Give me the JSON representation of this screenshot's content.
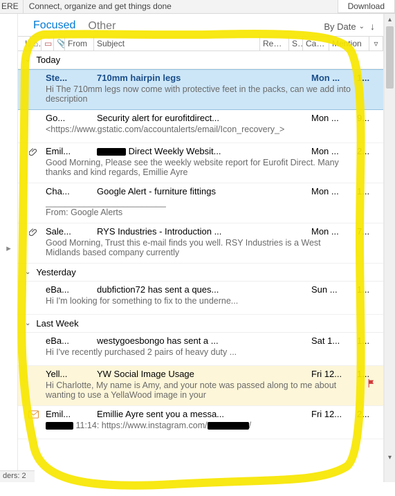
{
  "ribbon": {
    "truncated_tab": "ERE",
    "tagline": "Connect, organize and get things done",
    "download": "Download"
  },
  "tabs": {
    "focused": "Focused",
    "other": "Other",
    "sort_label": "By Date",
    "sort_chev": "⌄",
    "sort_dir": "↓"
  },
  "columns": {
    "importance": "!",
    "reminder": "⌂",
    "icon": "▭",
    "attach": "📎",
    "from": "From",
    "subject": "Subject",
    "received": "Recei...",
    "size": "S...",
    "categories": "Cate...",
    "mention": "Mention",
    "flag": "▿"
  },
  "groups": {
    "today": "Today",
    "yesterday": "Yesterday",
    "lastweek": "Last Week"
  },
  "today": [
    {
      "from": "Ste...",
      "subject": "710mm hairpin legs",
      "date": "Mon ...",
      "size": "1...",
      "preview": "Hi  The 710mm legs now come with protective feet in the packs, can we add into description"
    },
    {
      "from": "Go...",
      "subject": "Security alert for eurofitdirect...",
      "date": "Mon ...",
      "size": "9...",
      "preview": "<https://www.gstatic.com/accountalerts/email/Icon_recovery_>"
    },
    {
      "from": "Emil...",
      "subject_suffix": " Direct Weekly Websit...",
      "date": "Mon ...",
      "size": "2...",
      "preview": "Good Morning,  Please see the weekly website report for Eurofit Direct.    Many thanks and kind regards,   Emillie Ayre"
    },
    {
      "from": "Cha...",
      "subject": "Google Alert - furniture fittings",
      "date": "Mon ...",
      "size": "1...",
      "preview": "_________________________\nFrom: Google Alerts"
    },
    {
      "from": "Sale...",
      "subject": "RYS Industries - Introduction ...",
      "date": "Mon ...",
      "size": "7...",
      "preview": "Good Morning,  Trust this e-mail finds you well.     RSY Industries is a West Midlands based company currently"
    }
  ],
  "yesterday": [
    {
      "from": "eBa...",
      "subject": "dubfiction72 has sent a ques...",
      "date": "Sun ...",
      "size": "1...",
      "preview": "Hi I'm looking for something to fix to the underne..."
    }
  ],
  "lastweek": [
    {
      "from": "eBa...",
      "subject": "westygoesbongo has sent a ...",
      "date": "Sat 1...",
      "size": "1...",
      "preview": "Hi I've recently purchased 2 pairs of heavy duty ..."
    },
    {
      "from": "Yell...",
      "subject": "YW Social Image Usage",
      "date": "Fri 12...",
      "size": "1...",
      "preview": "Hi Charlotte,  My name is Amy, and your note was passed along to me about wanting to use a YellaWood image in your"
    },
    {
      "from": "Emil...",
      "subject": "Emillie Ayre sent you a messa...",
      "date": "Fri 12...",
      "size": "2...",
      "preview_prefix": "",
      "preview_time": " 11:14: https://www.instagram.com/",
      "preview_suffix": "/"
    }
  ],
  "status": {
    "count": "ders: 2"
  }
}
